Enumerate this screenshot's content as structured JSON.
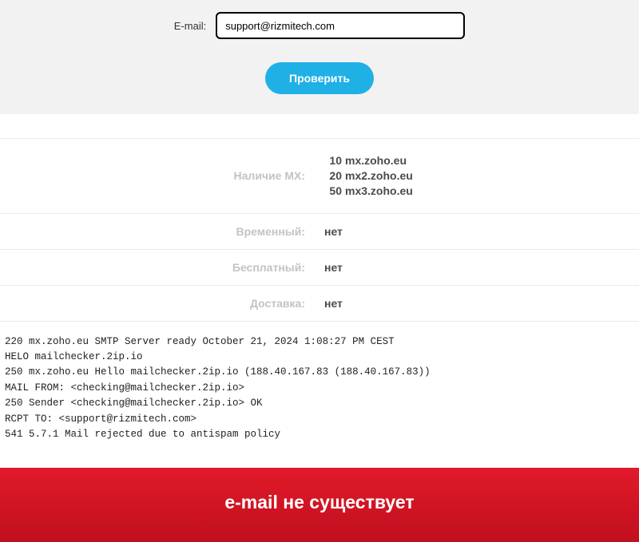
{
  "form": {
    "label": "E-mail:",
    "email_value": "support@rizmitech.com",
    "submit_label": "Проверить"
  },
  "results": {
    "mx_label": "Наличие MX:",
    "mx_records": [
      {
        "priority": "10",
        "host": "mx.zoho.eu"
      },
      {
        "priority": "20",
        "host": "mx2.zoho.eu"
      },
      {
        "priority": "50",
        "host": "mx3.zoho.eu"
      }
    ],
    "temporary_label": "Временный:",
    "temporary_value": "нет",
    "free_label": "Бесплатный:",
    "free_value": "нет",
    "delivery_label": "Доставка:",
    "delivery_value": "нет"
  },
  "smtp_log": "220 mx.zoho.eu SMTP Server ready October 21, 2024 1:08:27 PM CEST\nHELO mailchecker.2ip.io\n250 mx.zoho.eu Hello mailchecker.2ip.io (188.40.167.83 (188.40.167.83))\nMAIL FROM: <checking@mailchecker.2ip.io>\n250 Sender <checking@mailchecker.2ip.io> OK\nRCPT TO: <support@rizmitech.com>\n541 5.7.1 Mail rejected due to antispam policy",
  "banner": {
    "text": "e-mail не существует"
  }
}
